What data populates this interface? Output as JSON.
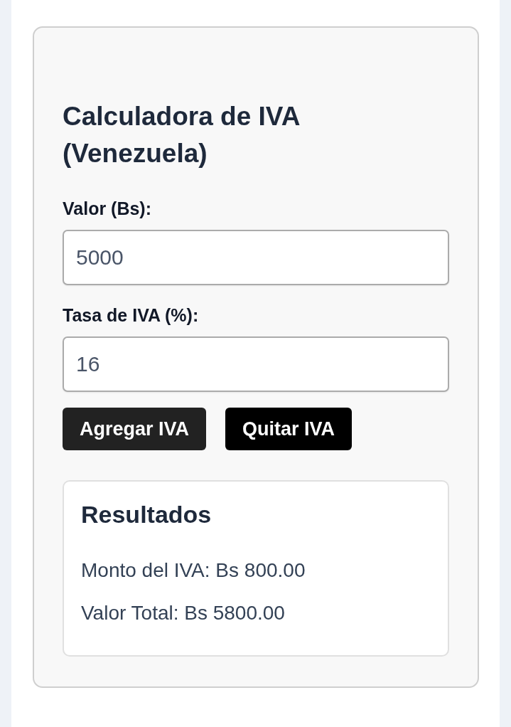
{
  "calculator": {
    "title": "Calculadora de IVA (Venezuela)",
    "fields": [
      {
        "label": "Valor (Bs):",
        "value": "5000"
      },
      {
        "label": "Tasa de IVA (%):",
        "value": "16"
      }
    ],
    "buttons": [
      {
        "label": "Agregar IVA",
        "color": "#222222"
      },
      {
        "label": "Quitar IVA",
        "color": "#000000"
      }
    ],
    "results": {
      "title": "Resultados",
      "lines": [
        "Monto del IVA: Bs 800.00",
        "Valor Total: Bs 5800.00"
      ]
    }
  }
}
